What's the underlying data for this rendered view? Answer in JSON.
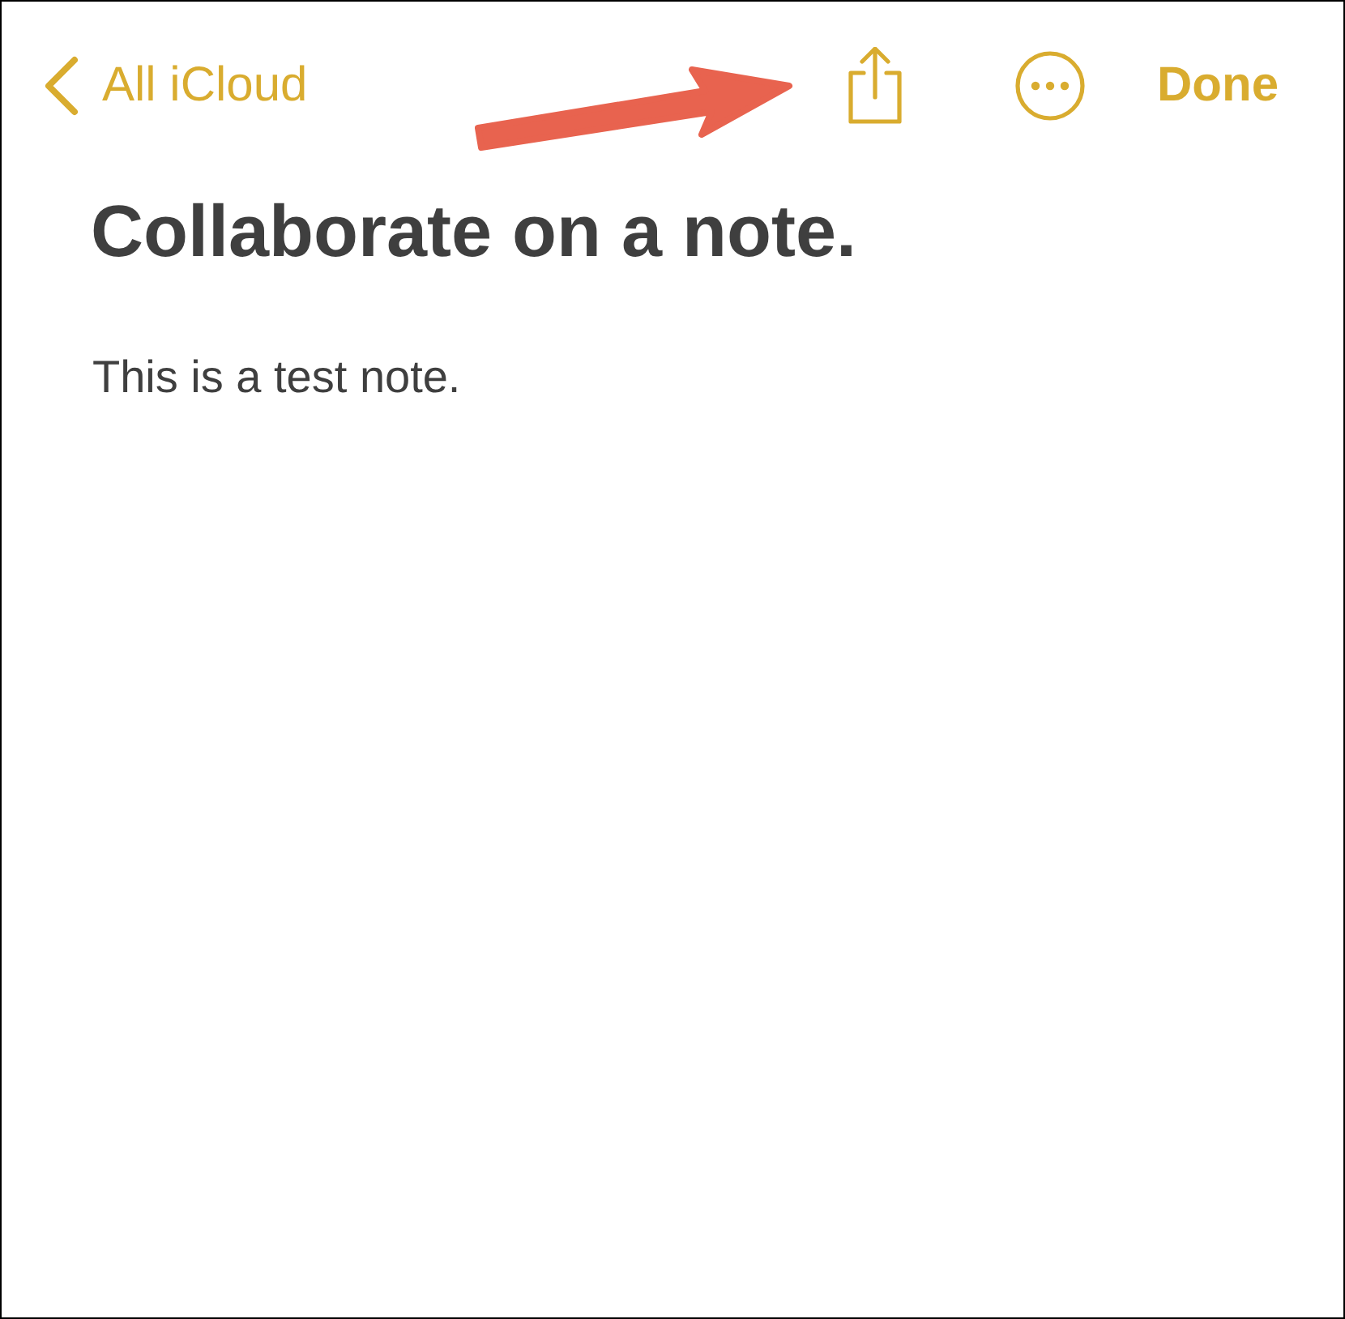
{
  "nav": {
    "back": "All iCloud",
    "done": "Done"
  },
  "note": {
    "title": "Collaborate on a note.",
    "body": "This is a test note."
  }
}
